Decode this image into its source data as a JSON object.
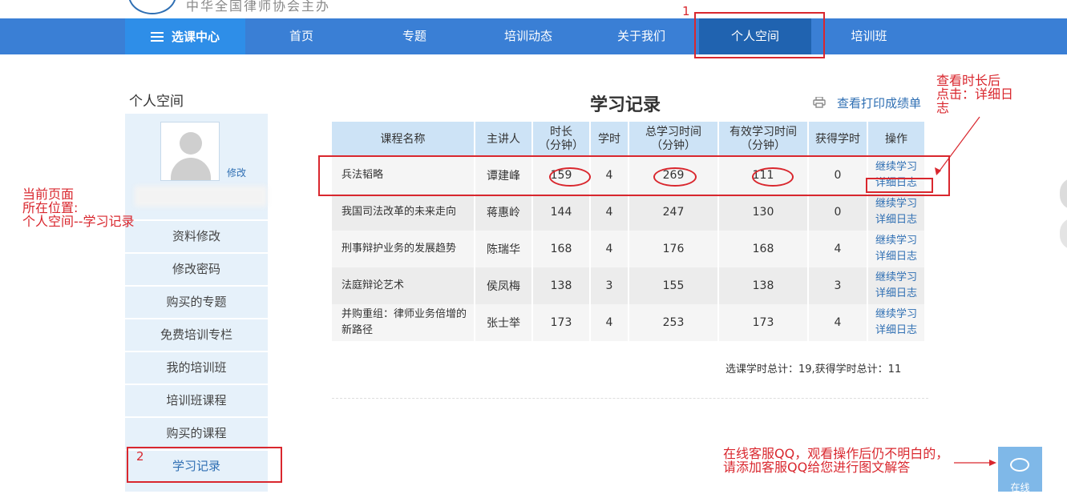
{
  "header": {
    "slogan": "中华全国律师协会主办"
  },
  "nav": {
    "category_label": "选课中心",
    "items": [
      {
        "label": "首页"
      },
      {
        "label": "专题"
      },
      {
        "label": "培训动态"
      },
      {
        "label": "关于我们"
      },
      {
        "label": "个人空间",
        "active": true
      },
      {
        "label": "培训班"
      }
    ]
  },
  "sidebar": {
    "title": "个人空间",
    "edit_label": "修改",
    "items": [
      {
        "label": "资料修改"
      },
      {
        "label": "修改密码"
      },
      {
        "label": "购买的专题"
      },
      {
        "label": "免费培训专栏"
      },
      {
        "label": "我的培训班"
      },
      {
        "label": "培训班课程"
      },
      {
        "label": "购买的课程"
      },
      {
        "label": "学习记录",
        "active": true
      }
    ]
  },
  "main": {
    "heading": "学习记录",
    "print_link": "查看打印成绩单",
    "columns": [
      {
        "line1": "课程名称",
        "line2": ""
      },
      {
        "line1": "主讲人",
        "line2": ""
      },
      {
        "line1": "时长",
        "line2": "（分钟）"
      },
      {
        "line1": "学时",
        "line2": ""
      },
      {
        "line1": "总学习时间",
        "line2": "（分钟）"
      },
      {
        "line1": "有效学习时间",
        "line2": "（分钟）"
      },
      {
        "line1": "获得学时",
        "line2": ""
      },
      {
        "line1": "操作",
        "line2": ""
      }
    ],
    "rows": [
      {
        "course": "兵法韬略",
        "lecturer": "谭建峰",
        "duration": "159",
        "hours": "4",
        "total_time": "269",
        "effective_time": "111",
        "earned": "0",
        "op_continue": "继续学习",
        "op_log": "详细日志"
      },
      {
        "course": "我国司法改革的未来走向",
        "lecturer": "蒋惠岭",
        "duration": "144",
        "hours": "4",
        "total_time": "247",
        "effective_time": "130",
        "earned": "0",
        "op_continue": "继续学习",
        "op_log": "详细日志"
      },
      {
        "course": "刑事辩护业务的发展趋势",
        "lecturer": "陈瑞华",
        "duration": "168",
        "hours": "4",
        "total_time": "176",
        "effective_time": "168",
        "earned": "4",
        "op_continue": "继续学习",
        "op_log": "详细日志"
      },
      {
        "course": "法庭辩论艺术",
        "lecturer": "侯凤梅",
        "duration": "138",
        "hours": "3",
        "total_time": "155",
        "effective_time": "138",
        "earned": "3",
        "op_continue": "继续学习",
        "op_log": "详细日志"
      },
      {
        "course": "并购重组：律师业务倍增的新路径",
        "lecturer": "张士举",
        "duration": "173",
        "hours": "4",
        "total_time": "253",
        "effective_time": "173",
        "earned": "4",
        "op_continue": "继续学习",
        "op_log": "详细日志"
      }
    ],
    "summary": "选课学时总计：19,获得学时总计：11"
  },
  "annotations": {
    "num1": "1",
    "num2": "2",
    "note_location_l1": "当前页面",
    "note_location_l2": "所在位置:",
    "note_location_l3": "个人空间--学习记录",
    "note_click_l1": "查看时长后",
    "note_click_l2": "点击：详细日",
    "note_click_l3": "志",
    "note_qq_l1": "在线客服QQ，观看操作后仍不明白的，",
    "note_qq_l2": "请添加客服QQ给您进行图文解答"
  },
  "qq": {
    "label": "在线"
  },
  "colors": {
    "nav_bg": "#3a7fd5",
    "nav_active": "#2063b0",
    "sidebar_bg": "#e6f1fa",
    "table_header": "#cde3f6",
    "link": "#2f6fb3",
    "annotation": "#d9272e"
  }
}
